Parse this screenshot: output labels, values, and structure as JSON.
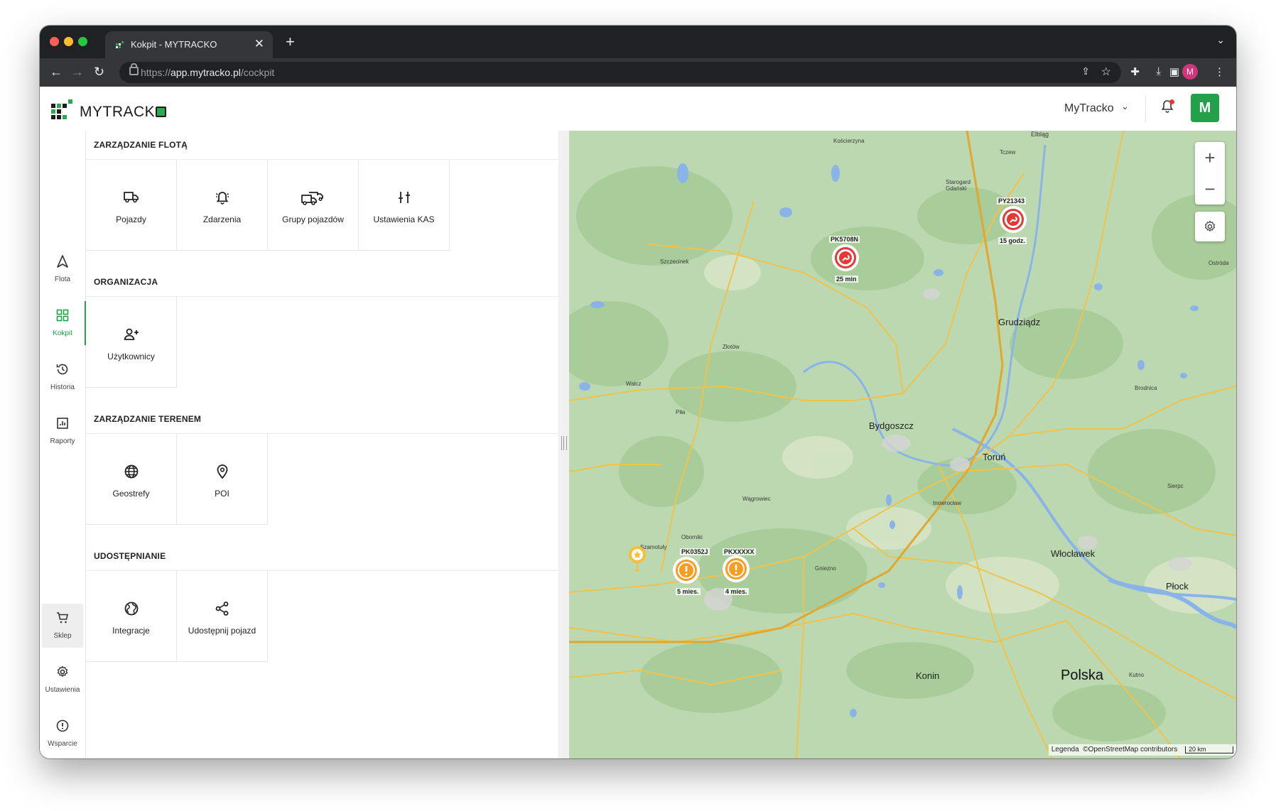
{
  "browser": {
    "tab_title": "Kokpit - MYTRACKO",
    "tab_close": "✕",
    "new_tab": "+",
    "url_scheme": "https://",
    "url_host": "app.mytracko.pl",
    "url_path": "/cockpit",
    "profile_initial": "M"
  },
  "header": {
    "logo_text": "MYTRACK",
    "tenant": "MyTracko",
    "avatar": "M",
    "brand_color": "#23a04a"
  },
  "sidebar": {
    "items": [
      {
        "label": "Flota",
        "icon": "navigation-icon"
      },
      {
        "label": "Kokpit",
        "icon": "grid-icon"
      },
      {
        "label": "Historia",
        "icon": "history-icon"
      },
      {
        "label": "Raporty",
        "icon": "report-icon"
      },
      {
        "label": "Sklep",
        "icon": "cart-icon"
      },
      {
        "label": "Ustawienia",
        "icon": "gear-icon"
      },
      {
        "label": "Wsparcie",
        "icon": "alert-circle-icon"
      }
    ]
  },
  "sections": [
    {
      "title": "ZARZĄDZANIE FLOTĄ",
      "tiles": [
        {
          "label": "Pojazdy",
          "icon": "truck-icon"
        },
        {
          "label": "Zdarzenia",
          "icon": "alarm-bell-icon"
        },
        {
          "label": "Grupy pojazdów",
          "icon": "trucks-group-icon"
        },
        {
          "label": "Ustawienia KAS",
          "icon": "sliders-icon"
        }
      ]
    },
    {
      "title": "ORGANIZACJA",
      "tiles": [
        {
          "label": "Użytkownicy",
          "icon": "user-add-icon"
        }
      ]
    },
    {
      "title": "ZARZĄDZANIE TERENEM",
      "tiles": [
        {
          "label": "Geostrefy",
          "icon": "globe-icon"
        },
        {
          "label": "POI",
          "icon": "map-pin-icon"
        }
      ]
    },
    {
      "title": "UDOSTĘPNIANIE",
      "tiles": [
        {
          "label": "Integracje",
          "icon": "earth-icon"
        },
        {
          "label": "Udostępnij pojazd",
          "icon": "share-icon"
        }
      ]
    }
  ],
  "map": {
    "cities": {
      "elblag": "Elbląg",
      "koscierzyna": "Kościerzyna",
      "czew": "Tczew",
      "starogard": "Starogard Gdański",
      "szczecinek": "Szczecinek",
      "ostroda": "Ostróda",
      "grudziadz": "Grudziądz",
      "zlotow": "Złotów",
      "walcz": "Wałcz",
      "brodnica": "Brodnica",
      "pila": "Piła",
      "bydgoszcz": "Bydgoszcz",
      "torun": "Toruń",
      "wagrowiec": "Wągrowiec",
      "inowroclaw": "Inowrocław",
      "sierpc": "Sierpc",
      "wloclawek": "Włocławek",
      "szamotuly": "Szamotuły",
      "oborniki": "Oborniki",
      "gniezno": "Gniezno",
      "plock": "Płock",
      "konin": "Konin",
      "polska": "Polska",
      "kutno": "Kutno"
    },
    "vehicles": [
      {
        "plate": "PK5708N",
        "time": "25 min",
        "status": "alarm",
        "color": "#e53935"
      },
      {
        "plate": "PY21343",
        "time": "15 godz.",
        "status": "alarm",
        "color": "#e53935"
      },
      {
        "plate": "PK0352J",
        "time": "5 mies.",
        "status": "warning",
        "color": "#f59d24"
      },
      {
        "plate": "PKXXXXX",
        "time": "4 mies.",
        "status": "warning",
        "color": "#f59d24"
      }
    ],
    "zoom_in": "+",
    "zoom_out": "−",
    "legend": "Legenda",
    "attribution": "©OpenStreetMap contributors",
    "scale": "20 km"
  }
}
